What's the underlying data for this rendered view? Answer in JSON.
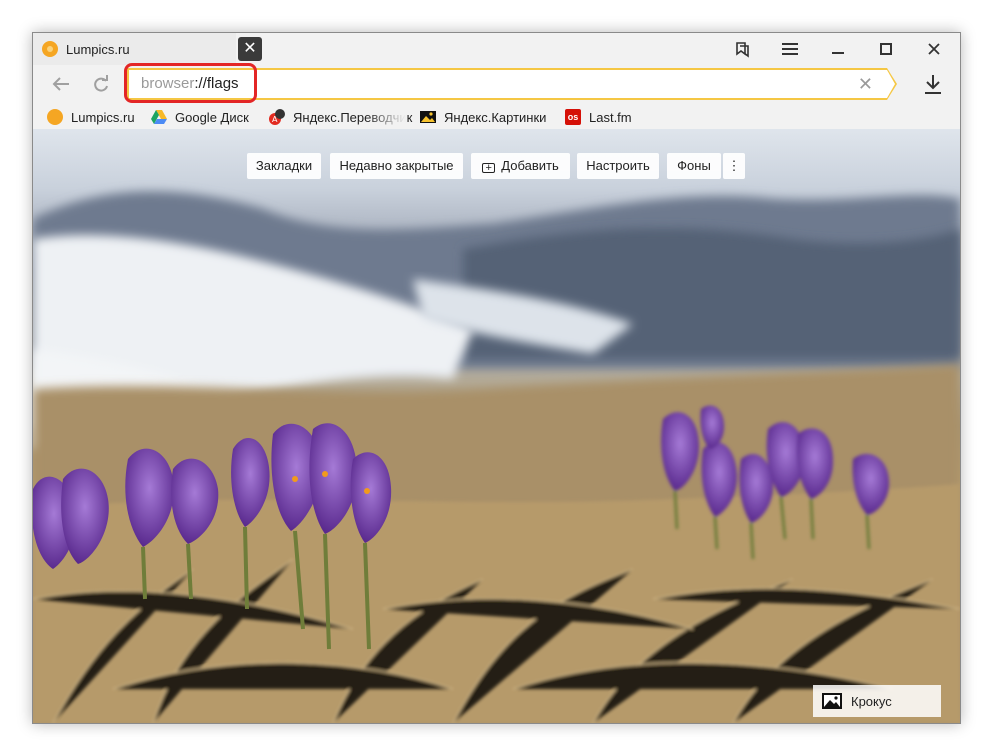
{
  "tab": {
    "title": "Lumpics.ru",
    "new_tab_glyph": "✕"
  },
  "window_controls": [
    "bookmarks-panel-icon",
    "menu-icon",
    "minimize-icon",
    "maximize-icon",
    "close-icon"
  ],
  "address_bar": {
    "url_scheme": "browser",
    "url_rest": "://flags",
    "clear_glyph": "✕"
  },
  "bookmarks": [
    {
      "label": "Lumpics.ru",
      "icon": "lumpics-icon"
    },
    {
      "label": "Google Диск",
      "icon": "google-drive-icon"
    },
    {
      "label": "Яндекс.Переводчик",
      "icon": "yandex-translate-icon"
    },
    {
      "label": "Яндекс.Картинки",
      "icon": "yandex-images-icon"
    },
    {
      "label": "Last.fm",
      "icon": "lastfm-icon",
      "badge": "os"
    }
  ],
  "top_menu": {
    "bookmarks": "Закладки",
    "recent": "Недавно закрытые",
    "add": "Добавить",
    "customize": "Настроить",
    "backgrounds": "Фоны",
    "more": "⋮"
  },
  "background_caption": "Крокус",
  "colors": {
    "address_accent": "#f5c744",
    "highlight": "#e32626",
    "lumpics": "#f5a623",
    "lastfm": "#d51007"
  }
}
